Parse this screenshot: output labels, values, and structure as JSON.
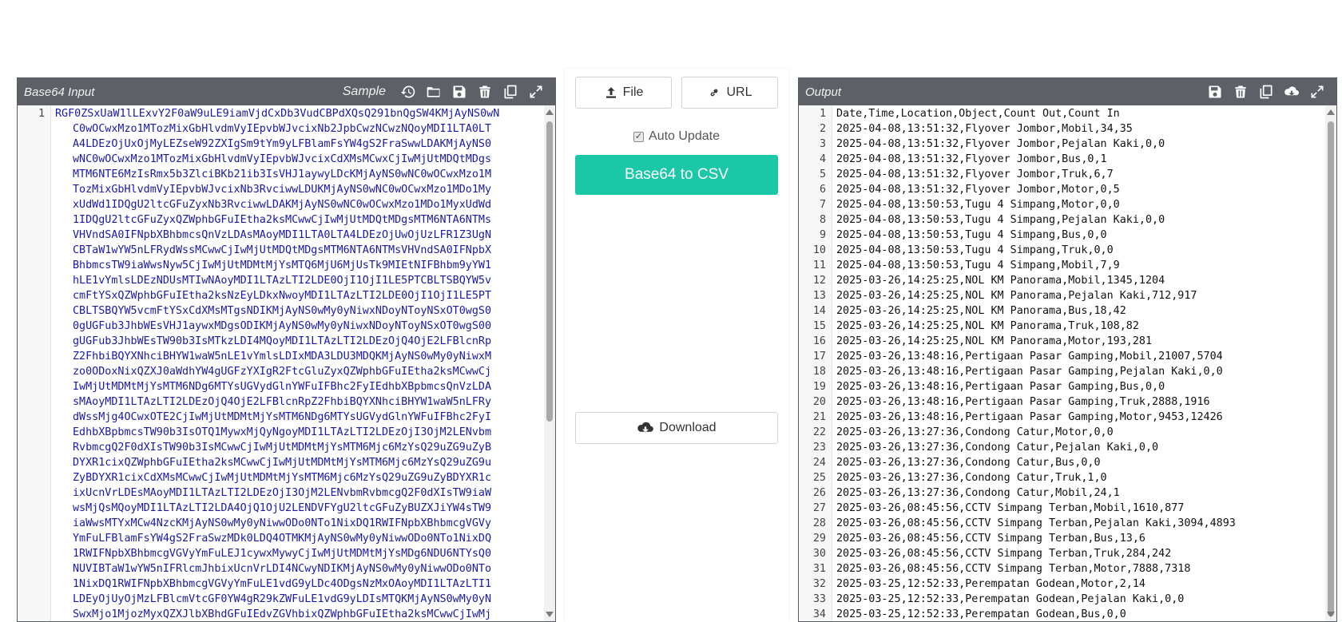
{
  "left_panel": {
    "title": "Base64 Input",
    "sample_label": "Sample",
    "line_numbers": [
      "1"
    ],
    "lines": [
      "RGF0ZSxUaW1lLExvY2F0aW9uLE9iamVjdCxDb3VudCBPdXQsQ291bnQgSW4KMjAyNS0wN",
      "C0wOCwxMzo1MTozMixGbHlvdmVyIEpvbWJvcixNb2JpbCwzNCwzNQoyMDI1LTA0LT",
      "A4LDEzOjUxOjMyLEZseW92ZXIgSm9tYm9yLFBlamFsYW4gS2FraSwwLDAKMjAyNS0",
      "wNC0wOCwxMzo1MTozMixGbHlvdmVyIEpvbWJvcixCdXMsMCwxCjIwMjUtMDQtMDgs",
      "MTM6NTE6MzIsRmx5b3ZlciBKb21ib3IsVHJ1aywyLDcKMjAyNS0wNC0wOCwxMzo1M",
      "TozMixGbHlvdmVyIEpvbWJvcixNb3RvciwwLDUKMjAyNS0wNC0wOCwxMzo1MDo1My",
      "xUdWd1IDQgU2ltcGFuZyxNb3RvciwwLDAKMjAyNS0wNC0wOCwxMzo1MDo1MyxUdWd",
      "1IDQgU2ltcGFuZyxQZWphbGFuIEtha2ksMCwwCjIwMjUtMDQtMDgsMTM6NTA6NTMs",
      "VHVndSA0IFNpbXBhbmcsQnVzLDAsMAoyMDI1LTA0LTA4LDEzOjUwOjUzLFR1Z3UgN",
      "CBTaW1wYW5nLFRydWssMCwwCjIwMjUtMDQtMDgsMTM6NTA6NTMsVHVndSA0IFNpbX",
      "BhbmcsTW9iaWwsNyw5CjIwMjUtMDMtMjYsMTQ6MjU6MjUsTk9MIEtNIFBhbm9yYW1",
      "hLE1vYmlsLDEzNDUsMTIwNAoyMDI1LTAzLTI2LDE0OjI1OjI1LE5PTCBLTSBQYW5v",
      "cmFtYSxQZWphbGFuIEtha2ksNzEyLDkxNwoyMDI1LTAzLTI2LDE0OjI1OjI1LE5PT",
      "CBLTSBQYW5vcmFtYSxCdXMsMTgsNDIKMjAyNS0wMy0yNiwxNDoyNToyNSxOT0wgS0",
      "0gUGFub3JhbWEsVHJ1aywxMDgsODIKMjAyNS0wMy0yNiwxNDoyNToyNSxOT0wgS00",
      "gUGFub3JhbWEsTW90b3IsMTkzLDI4MQoyMDI1LTAzLTI2LDEzOjQ4OjE2LFBlcnRp",
      "Z2FhbiBQYXNhciBHYW1waW5nLE1vYmlsLDIxMDA3LDU3MDQKMjAyNS0wMy0yNiwxM",
      "zo0ODoxNixQZXJ0aWdhYW4gUGFzYXIgR2FtcGluZyxQZWphbGFuIEtha2ksMCwwCj",
      "IwMjUtMDMtMjYsMTM6NDg6MTYsUGVydGlnYWFuIFBhc2FyIEdhbXBpbmcsQnVzLDA",
      "sMAoyMDI1LTAzLTI2LDEzOjQ4OjE2LFBlcnRpZ2FhbiBQYXNhciBHYW1waW5nLFRy",
      "dWssMjg4OCwxOTE2CjIwMjUtMDMtMjYsMTM6NDg6MTYsUGVydGlnYWFuIFBhc2FyI",
      "EdhbXBpbmcsTW90b3IsOTQ1MywxMjQyNgoyMDI1LTAzLTI2LDEzOjI3OjM2LENvbm",
      "RvbmcgQ2F0dXIsTW90b3IsMCwwCjIwMjUtMDMtMjYsMTM6Mjc6MzYsQ29uZG9uZyB",
      "DYXR1cixQZWphbGFuIEtha2ksMCwwCjIwMjUtMDMtMjYsMTM6Mjc6MzYsQ29uZG9u",
      "ZyBDYXR1cixCdXMsMCwwCjIwMjUtMDMtMjYsMTM6Mjc6MzYsQ29uZG9uZyBDYXR1c",
      "ixUcnVrLDEsMAoyMDI1LTAzLTI2LDEzOjI3OjM2LENvbmRvbmcgQ2F0dXIsTW9iaW",
      "wsMjQsMQoyMDI1LTAzLTI2LDA4OjQ1OjU2LENDVFYgU2ltcGFuZyBUZXJiYW4sTW9",
      "iaWwsMTYxMCw4NzcKMjAyNS0wMy0yNiwwODo0NTo1NixDQ1RWIFNpbXBhbmcgVGVy",
      "YmFuLFBlamFsYW4gS2FraSwzMDk0LDQ4OTMKMjAyNS0wMy0yNiwwODo0NTo1NixDQ",
      "1RWIFNpbXBhbmcgVGVyYmFuLEJ1cywxMywyCjIwMjUtMDMtMjYsMDg6NDU6NTYsQ0",
      "NUVIBTaW1wYW5nIFRlcmJhbixUcnVrLDI4NCwyNDIKMjAyNS0wMy0yNiwwODo0NTo",
      "1NixDQ1RWIFNpbXBhbmcgVGVyYmFuLE1vdG9yLDc4ODgsNzMxOAoyMDI1LTAzLTI1",
      "LDEyOjUyOjMzLFBlcmVtcGF0YW4gR29kZWFuLE1vdG9yLDIsMTQKMjAyNS0wMy0yN",
      "SwxMjo1MjozMyxQZXJlbXBhdGFuIEdvZGVhbixQZWphbGFuIEtha2ksMCwwCjIwMj"
    ]
  },
  "middle": {
    "file_label": "File",
    "url_label": "URL",
    "auto_update_label": "Auto Update",
    "auto_update_checked": true,
    "convert_label": "Base64 to CSV",
    "download_label": "Download",
    "accent_color": "#1ac8a8"
  },
  "right_panel": {
    "title": "Output",
    "line_numbers": [
      "1",
      "2",
      "3",
      "4",
      "5",
      "6",
      "7",
      "8",
      "9",
      "10",
      "11",
      "12",
      "13",
      "14",
      "15",
      "16",
      "17",
      "18",
      "19",
      "20",
      "21",
      "22",
      "23",
      "24",
      "25",
      "26",
      "27",
      "28",
      "29",
      "30",
      "31",
      "32",
      "33",
      "34"
    ],
    "lines": [
      "Date,Time,Location,Object,Count Out,Count In",
      "2025-04-08,13:51:32,Flyover Jombor,Mobil,34,35",
      "2025-04-08,13:51:32,Flyover Jombor,Pejalan Kaki,0,0",
      "2025-04-08,13:51:32,Flyover Jombor,Bus,0,1",
      "2025-04-08,13:51:32,Flyover Jombor,Truk,6,7",
      "2025-04-08,13:51:32,Flyover Jombor,Motor,0,5",
      "2025-04-08,13:50:53,Tugu 4 Simpang,Motor,0,0",
      "2025-04-08,13:50:53,Tugu 4 Simpang,Pejalan Kaki,0,0",
      "2025-04-08,13:50:53,Tugu 4 Simpang,Bus,0,0",
      "2025-04-08,13:50:53,Tugu 4 Simpang,Truk,0,0",
      "2025-04-08,13:50:53,Tugu 4 Simpang,Mobil,7,9",
      "2025-03-26,14:25:25,NOL KM Panorama,Mobil,1345,1204",
      "2025-03-26,14:25:25,NOL KM Panorama,Pejalan Kaki,712,917",
      "2025-03-26,14:25:25,NOL KM Panorama,Bus,18,42",
      "2025-03-26,14:25:25,NOL KM Panorama,Truk,108,82",
      "2025-03-26,14:25:25,NOL KM Panorama,Motor,193,281",
      "2025-03-26,13:48:16,Pertigaan Pasar Gamping,Mobil,21007,5704",
      "2025-03-26,13:48:16,Pertigaan Pasar Gamping,Pejalan Kaki,0,0",
      "2025-03-26,13:48:16,Pertigaan Pasar Gamping,Bus,0,0",
      "2025-03-26,13:48:16,Pertigaan Pasar Gamping,Truk,2888,1916",
      "2025-03-26,13:48:16,Pertigaan Pasar Gamping,Motor,9453,12426",
      "2025-03-26,13:27:36,Condong Catur,Motor,0,0",
      "2025-03-26,13:27:36,Condong Catur,Pejalan Kaki,0,0",
      "2025-03-26,13:27:36,Condong Catur,Bus,0,0",
      "2025-03-26,13:27:36,Condong Catur,Truk,1,0",
      "2025-03-26,13:27:36,Condong Catur,Mobil,24,1",
      "2025-03-26,08:45:56,CCTV Simpang Terban,Mobil,1610,877",
      "2025-03-26,08:45:56,CCTV Simpang Terban,Pejalan Kaki,3094,4893",
      "2025-03-26,08:45:56,CCTV Simpang Terban,Bus,13,6",
      "2025-03-26,08:45:56,CCTV Simpang Terban,Truk,284,242",
      "2025-03-26,08:45:56,CCTV Simpang Terban,Motor,7888,7318",
      "2025-03-25,12:52:33,Perempatan Godean,Motor,2,14",
      "2025-03-25,12:52:33,Perempatan Godean,Pejalan Kaki,0,0",
      "2025-03-25,12:52:33,Perempatan Godean,Bus,0,0"
    ]
  },
  "icons": {
    "history": "history-icon",
    "folder": "folder-open-icon",
    "save": "save-icon",
    "trash": "trash-icon",
    "copy": "copy-icon",
    "expand": "expand-icon",
    "upload": "upload-icon",
    "link": "link-icon",
    "cloud_download": "cloud-download-icon"
  }
}
